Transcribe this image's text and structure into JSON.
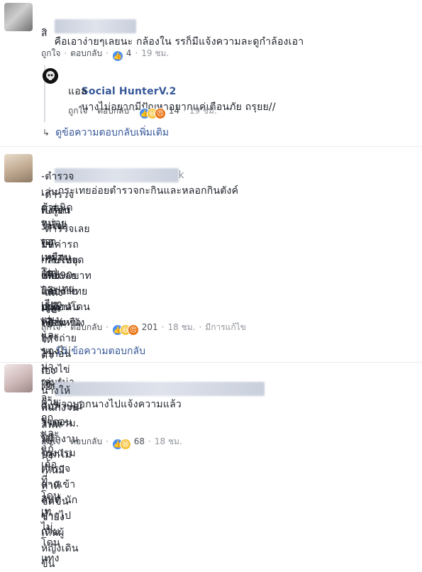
{
  "comments": [
    {
      "text_line1": "คือเอาง่ายๆเลยนะ กล้องใน รรก็มีแจ้งความละดูกำล้องเอา",
      "text_line2": "สิ",
      "like_label": "ถูกใจ",
      "reply_label": "ตอบกลับ",
      "reaction_count": "4",
      "time": "19 ชม.",
      "reply": {
        "author": "Social HunterV.2",
        "text_line1": "นางไม่อยากมีปัญหาอยากแค่เตือนภัย ถรุยย//",
        "text_line2": "แอล",
        "like_label": "ถูกใจ",
        "reply_label": "ตอบกลับ",
        "reaction_count": "14",
        "time": "19 ชม."
      },
      "more_replies": "ดูข้อความตอบกลับเพิ่มเติม"
    },
    {
      "name_suffix": "k",
      "text_first": "-กระเทยอ่อยตำรวจกะกินและหลอกกินตังค์",
      "lines": [
        "-ตำรวจเล่นด้วยนิดหน่อย",
        "-ตำรวจเปลี่ยนใจไม่เอาเพราะโดนกระเทยเรียกแพง และของไม่น่าเล่น(น่าจะ",
        "พึ่งรู้ตัวว่าเจอตอเหมือนกัน)",
        "-ตำรวจเลยมห้ค่ารถกลับไปจุดขาย90บาทแต่กระเทยเหมือนโดนหยามหนัง",
        "ไข่",
        "-กระเทยแค้นเลยแอบถ่ายมาด่าลับหลัง(หรืออาจถ่ายไว้ก่อนถ่างไข่ให้เห็น",
        "เพื่อไปอวดเพื่อน",
        "-แต่งเรื่องไปให้ตัวเองเป็นฝ่ายถูกและแก้เก้อที่โดนเทไม่โดนแทง",
        "-จบ"
      ],
      "like_label": "ถูกใจ",
      "reply_label": "ตอบกลับ",
      "reaction_count": "201",
      "time": "18 ชม.",
      "edited": "มีการแก้ไข",
      "replies_count": "15 ข้อความตอบกลับ"
    },
    {
      "text_first": "ข่าวบอกนางไปแจ้งความแล้ว",
      "lines": [
        "นางให้สัมภาษณ์ว่าตอนไป โรงแรม ตำรวจลากเข้าลิฟท์ นักข่าวไปถาม",
        "พนักงานโรงแรม. พนักงานบอกไม่เห็นมีท่าทีขัดขืน ซ้ำยังเห็นผู้หญิงเดินขึ้น",
        "ลิฟท์ไป !!!"
      ],
      "like_label": "ถูกใจ",
      "reply_label": "ตอบกลับ",
      "reaction_count": "68",
      "time": "18 ชม."
    }
  ],
  "icons": {
    "like": "like-icon",
    "haha": "haha-icon",
    "angry": "angry-icon",
    "reply_arrow": "reply-arrow-icon"
  },
  "colors": {
    "link": "#365899",
    "meta": "#90949c",
    "like": "#4a8ff5",
    "haha": "#f5c33b",
    "angry": "#e9710f"
  }
}
